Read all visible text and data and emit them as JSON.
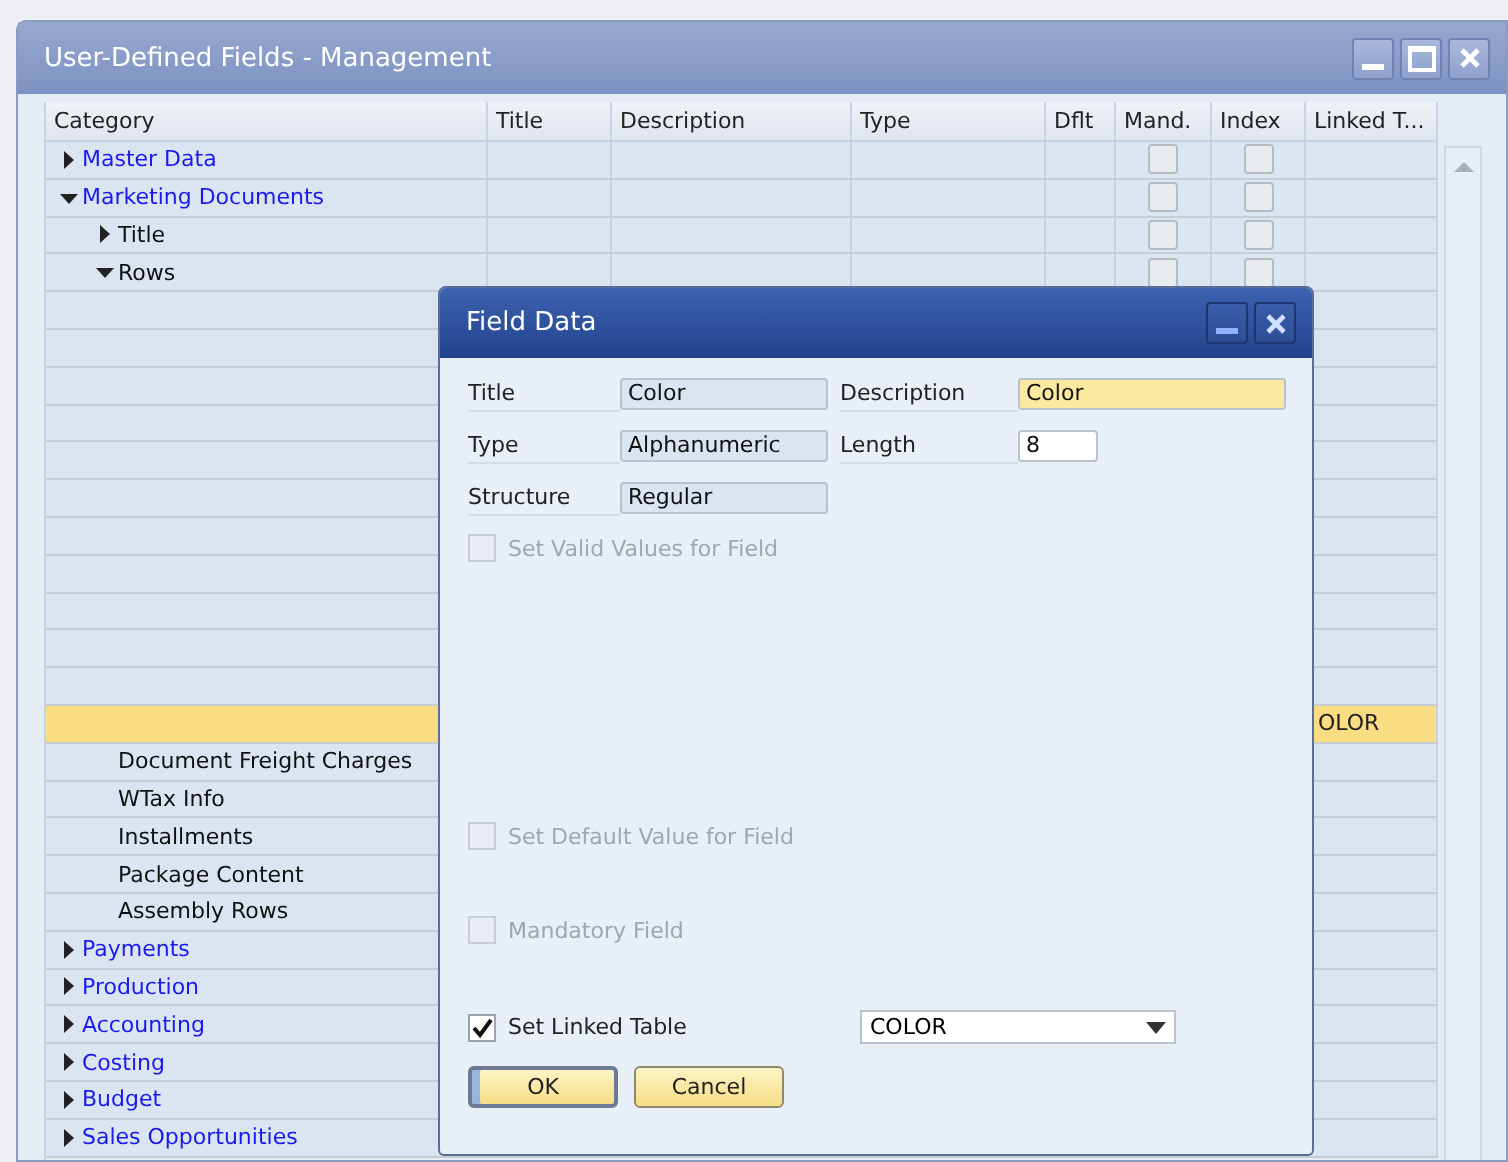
{
  "window": {
    "title": "User-Defined Fields - Management"
  },
  "grid": {
    "columns": [
      "Category",
      "Title",
      "Description",
      "Type",
      "Dflt",
      "Mand.",
      "Index",
      "Linked T..."
    ],
    "rows": [
      {
        "category": "Master Data",
        "expanded": false,
        "selected": false,
        "mandatory": false,
        "index": false
      },
      {
        "category": "Marketing Documents",
        "expanded": true,
        "selected": false,
        "mandatory": false,
        "index": false,
        "children": [
          {
            "category": "Title",
            "expanded": false,
            "selected": false,
            "mandatory": false,
            "index": false
          },
          {
            "category": "Rows",
            "expanded": true,
            "selected": false,
            "mandatory": false,
            "index": false,
            "children": [
              {
                "selected": false
              },
              {
                "selected": false
              },
              {
                "selected": false
              },
              {
                "selected": false
              },
              {
                "selected": false
              },
              {
                "selected": false
              },
              {
                "selected": false
              },
              {
                "selected": false
              },
              {
                "selected": false
              },
              {
                "selected": false
              },
              {
                "selected": false
              },
              {
                "selected": true,
                "linked_table": "OLOR"
              }
            ]
          },
          {
            "category": "Document Freight Charges",
            "selected": false
          },
          {
            "category": "WTax Info",
            "selected": false
          },
          {
            "category": "Installments",
            "selected": false
          },
          {
            "category": "Package Content",
            "selected": false
          },
          {
            "category": "Assembly Rows",
            "selected": false
          }
        ]
      },
      {
        "category": "Payments",
        "expanded": false,
        "selected": false
      },
      {
        "category": "Production",
        "expanded": false,
        "selected": false
      },
      {
        "category": "Accounting",
        "expanded": false,
        "selected": false
      },
      {
        "category": "Costing",
        "expanded": false,
        "selected": false
      },
      {
        "category": "Budget",
        "expanded": false,
        "selected": false
      },
      {
        "category": "Sales Opportunities",
        "expanded": false,
        "selected": false
      }
    ]
  },
  "dialog": {
    "title": "Field Data",
    "fields": [
      {
        "label": "Title",
        "value": "Color",
        "kind": "readonly"
      },
      {
        "label": "Description",
        "value": "Color",
        "kind": "focused"
      },
      {
        "label": "Type",
        "value": "Alphanumeric",
        "kind": "readonly"
      },
      {
        "label": "Length",
        "value": "8",
        "kind": "short"
      },
      {
        "label": "Structure",
        "value": "Regular",
        "kind": "readonly"
      }
    ],
    "checkboxes": [
      {
        "label": "Set Valid Values for Field",
        "checked": false,
        "disabled": true
      },
      {
        "label": "Set Default Value for Field",
        "checked": false,
        "disabled": true
      },
      {
        "label": "Mandatory Field",
        "checked": false,
        "disabled": true
      },
      {
        "label": "Set Linked Table",
        "checked": true,
        "disabled": false,
        "dropdown": "COLOR"
      }
    ],
    "buttons": [
      "OK",
      "Cancel"
    ]
  }
}
